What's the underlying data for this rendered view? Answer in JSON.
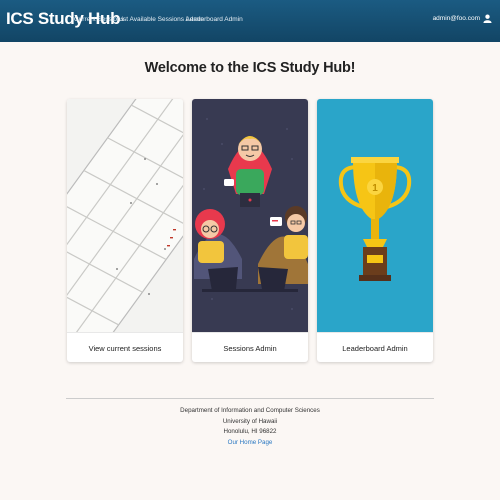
{
  "navbar": {
    "brand": "ICS Study Hub",
    "links": [
      "Current Sessions",
      "List Available Sessions Admin",
      "Leaderboard Admin"
    ],
    "user_email": "admin@foo.com"
  },
  "main": {
    "welcome": "Welcome to the ICS Study Hub!",
    "cards": [
      {
        "label": "View current sessions",
        "image_icon": "calendar-image"
      },
      {
        "label": "Sessions Admin",
        "image_icon": "study-group-image"
      },
      {
        "label": "Leaderboard Admin",
        "image_icon": "trophy-image"
      }
    ]
  },
  "footer": {
    "line1": "Department of Information and Computer Sciences",
    "line2": "University of Hawaii",
    "line3": "Honolulu, HI 96822",
    "home_link": "Our Home Page"
  },
  "colors": {
    "navbar": "#1b5b82",
    "background": "#fbf7f4",
    "trophy_bg": "#2aa5c9",
    "study_bg": "#383a52",
    "link": "#2a78c2"
  }
}
